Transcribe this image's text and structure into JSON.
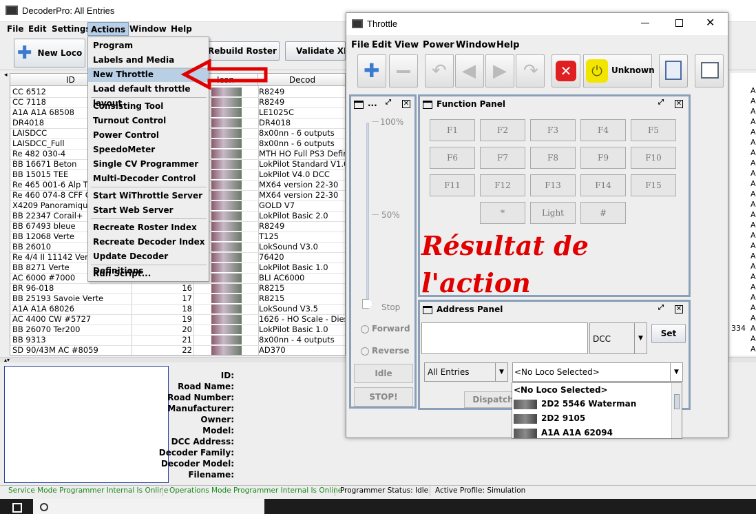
{
  "main_window": {
    "title": "DecoderPro: All Entries",
    "menu": [
      "File",
      "Edit",
      "Settings",
      "Actions",
      "Window",
      "Help"
    ],
    "toolbar": {
      "new_loco": "New Loco",
      "rebuild_roster": "Rebuild Roster",
      "validate_xml": "Validate XMI"
    },
    "table": {
      "columns": {
        "id": "ID",
        "icon": "Icon",
        "decoder": "Decod"
      },
      "rows": [
        {
          "id": "CC 6512",
          "num": "",
          "decoder": "R8249"
        },
        {
          "id": "CC 7118",
          "num": "",
          "decoder": "R8249"
        },
        {
          "id": "A1A A1A 68508",
          "num": "",
          "decoder": "LE1025C"
        },
        {
          "id": "DR4018",
          "num": "",
          "decoder": "DR4018"
        },
        {
          "id": "LAISDCC",
          "num": "",
          "decoder": "8x00nn - 6 outputs"
        },
        {
          "id": "LAISDCC_Full",
          "num": "",
          "decoder": "8x00nn - 6 outputs"
        },
        {
          "id": "Re 482 030-4",
          "num": "",
          "decoder": "MTH HO Full PS3 Defir"
        },
        {
          "id": "BB 16671 Beton",
          "num": "",
          "decoder": "LokPilot Standard V1.0"
        },
        {
          "id": "BB 15015 TEE",
          "num": "",
          "decoder": "LokPilot V4.0 DCC"
        },
        {
          "id": "Re 465 001-6 Alp Tr",
          "num": "",
          "decoder": "MX64 version 22-30"
        },
        {
          "id": "Re 460 074-8 CFF C",
          "num": "",
          "decoder": "MX64 version 22-30"
        },
        {
          "id": "X4209 Panoramique",
          "num": "",
          "decoder": "GOLD V7"
        },
        {
          "id": "BB 22347 Corail+",
          "num": "",
          "decoder": "LokPilot Basic 2.0"
        },
        {
          "id": "BB 67493 bleue",
          "num": "",
          "decoder": "R8249"
        },
        {
          "id": "BB 12068 Verte",
          "num": "",
          "decoder": "T125"
        },
        {
          "id": "BB 26010",
          "num": "",
          "decoder": "LokSound V3.0"
        },
        {
          "id": "Re 4/4 II 11142 Verte",
          "num": "",
          "decoder": "76420"
        },
        {
          "id": "BB 8271 Verte",
          "num": "",
          "decoder": "LokPilot Basic 1.0"
        },
        {
          "id": "AC 6000 #7000",
          "num": "",
          "decoder": "BLI AC6000"
        },
        {
          "id": "BR 96-018",
          "num": "16",
          "decoder": "R8215"
        },
        {
          "id": "BB 25193 Savoie Verte",
          "num": "17",
          "decoder": "R8215"
        },
        {
          "id": "A1A A1A 68026",
          "num": "18",
          "decoder": "LokSound V3.5"
        },
        {
          "id": "AC 4400 CW #5727",
          "num": "19",
          "decoder": "1626 - HO Scale - Dies"
        },
        {
          "id": "BB 26070 Ter200",
          "num": "20",
          "decoder": "LokPilot Basic 1.0"
        },
        {
          "id": "BB 9313",
          "num": "21",
          "decoder": "8x00nn - 4 outputs"
        },
        {
          "id": "SD 90/43M AC #8059",
          "num": "22",
          "decoder": "AD370"
        }
      ],
      "right_col_letter": "A",
      "right_col_value": "334"
    },
    "details": {
      "labels": [
        "ID:",
        "Road Name:",
        "Road Number:",
        "Manufacturer:",
        "Owner:",
        "Model:",
        "DCC Address:",
        "Decoder Family:",
        "Decoder Model:",
        "Filename:"
      ]
    },
    "status": {
      "service": "Service Mode Programmer Internal Is Online",
      "operations": "Operations Mode Programmer Internal Is Online",
      "programmer": "Programmer Status:  Idle",
      "profile": "Active Profile: Simulation"
    }
  },
  "actions_menu": {
    "items": [
      "Program",
      "Labels and Media",
      "New Throttle",
      "Load default throttle layout",
      "Consisting Tool",
      "Turnout Control",
      "Power Control",
      "SpeedoMeter",
      "Single CV Programmer",
      "Multi-Decoder Control",
      "Start WiThrottle Server",
      "Start Web Server",
      "Recreate Roster Index",
      "Recreate Decoder Index",
      "Update Decoder Definitions",
      "Run Script..."
    ],
    "selected": "New Throttle"
  },
  "throttle_window": {
    "title": "Throttle",
    "menu": [
      "File",
      "Edit",
      "View",
      "Power",
      "Window",
      "Help"
    ],
    "power_status": "Unknown",
    "control_panel": {
      "title": "...",
      "ticks": [
        "100%",
        "50%"
      ],
      "stop": "Stop",
      "forward": "Forward",
      "reverse": "Reverse",
      "idle": "Idle",
      "stop_button": "STOP!"
    },
    "function_panel": {
      "title": "Function Panel",
      "keys": [
        "F1",
        "F2",
        "F3",
        "F4",
        "F5",
        "F6",
        "F7",
        "F8",
        "F9",
        "F10",
        "F11",
        "F12",
        "F13",
        "F14",
        "F15",
        "*",
        "Light",
        "#"
      ]
    },
    "address_panel": {
      "title": "Address Panel",
      "protocol": "DCC",
      "set": "Set",
      "roster_group": "All Entries",
      "loco_select": "<No Loco Selected>",
      "dispatch": "Dispatch",
      "dropdown": [
        "<No Loco Selected>",
        "2D2 5546 Waterman",
        "2D2 9105",
        "A1A A1A 62094"
      ]
    }
  },
  "annotation": {
    "text_line1": "Résultat de",
    "text_line2": "l'action",
    "arrow_color": "#e00000"
  }
}
